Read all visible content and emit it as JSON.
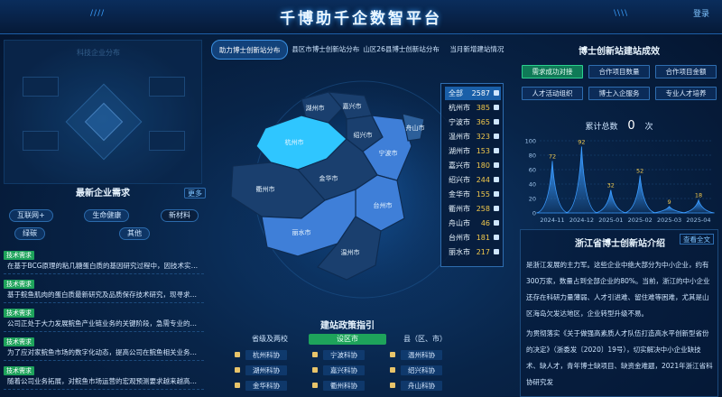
{
  "header": {
    "title": "千博助千企数智平台",
    "login_label": "登录",
    "deco_left": "////",
    "deco_right": "\\\\\\\\"
  },
  "left": {
    "faint_title": "科技企业分布",
    "demand_title": "最新企业需求",
    "demand_more": "更多",
    "tags_row1": [
      "互联网+",
      "生命健康",
      "新材料"
    ],
    "tags_row2": [
      "绿碳",
      "其他"
    ],
    "badge_label": "技术需求",
    "demands": [
      "在基于BCG原理的粘几糖蛋白质的基因研究过程中，因技术实现、数...",
      "基于鲩鱼肌肉的蛋白质最新研究及品质保存技术研究，现寻求专...",
      "公司正处于大力发展鲩鱼产业链业务的关键阶段，急需专业的鲩鱼...",
      "为了应对家鲩鱼市场的数字化动态，提高公司在鲩鱼相关业务的...",
      "随着公司业务拓展，对鲩鱼市场运营的宏观预测要求越来越高，现需..."
    ]
  },
  "center": {
    "tabs": [
      "助力博士创新站分布",
      "县区市博士创新站分布",
      "山区26县博士创新站分布",
      "当月新增建站情况"
    ],
    "map_labels": {
      "hz": "杭州市",
      "jx": "嘉兴市",
      "huz": "湖州市",
      "sx": "绍兴市",
      "nb": "宁波市",
      "zs": "舟山市",
      "jh": "金华市",
      "qz": "衢州市",
      "tz": "台州市",
      "ls": "丽水市",
      "wz": "温州市"
    },
    "city_list": [
      {
        "name": "全部",
        "value": "2587"
      },
      {
        "name": "杭州市",
        "value": "385"
      },
      {
        "name": "宁波市",
        "value": "365"
      },
      {
        "name": "温州市",
        "value": "323"
      },
      {
        "name": "湖州市",
        "value": "153"
      },
      {
        "name": "嘉兴市",
        "value": "180"
      },
      {
        "name": "绍兴市",
        "value": "244"
      },
      {
        "name": "金华市",
        "value": "155"
      },
      {
        "name": "衢州市",
        "value": "258"
      },
      {
        "name": "舟山市",
        "value": "46"
      },
      {
        "name": "台州市",
        "value": "181"
      },
      {
        "name": "丽水市",
        "value": "217"
      }
    ],
    "policy_title": "建站政策指引",
    "policy_tabs": [
      "省级及两校",
      "设区市",
      "县（区、市）"
    ],
    "policy_rows": [
      [
        "杭州科协",
        "宁波科协",
        "温州科协"
      ],
      [
        "湖州科协",
        "嘉兴科协",
        "绍兴科协"
      ],
      [
        "金华科协",
        "衢州科协",
        "舟山科协"
      ]
    ]
  },
  "right": {
    "results_title": "博士创新站建站成效",
    "btn_row1": [
      "需求成功对接",
      "合作项目数量",
      "合作项目金额"
    ],
    "btn_row2": [
      "人才活动组织",
      "博士入企服务",
      "专业人才培养"
    ],
    "total_label": "累计总数",
    "total_value": "0",
    "total_unit": "次",
    "intro_title": "浙江省博士创新站介绍",
    "intro_more": "查看全文",
    "intro_paragraphs": [
      "是浙江发展的主力军。这些企业中绝大部分为中小企业，约有300万家，数量占到全部企业的80%。当前，浙江的中小企业还存在科研力量薄弱、人才引进难、留住难等困难，尤其是山区海岛欠发达地区，企业转型升级不易。",
      "为贯彻落实《关于做强高素质人才队伍打造高水平创新型省份的决定》（浙委发〔2020〕19号），切实解决中小企业缺技术、缺人才，青年博士缺项目、缺资金难题，2021年浙江省科协研究发"
    ]
  },
  "chart_data": {
    "type": "area",
    "categories": [
      "2024-11",
      "2024-12",
      "2025-01",
      "2025-02",
      "2025-03",
      "2025-04"
    ],
    "values": [
      72,
      92,
      32,
      52,
      9,
      18
    ],
    "ylim": [
      0,
      100
    ],
    "yticks": [
      "0",
      "20",
      "40",
      "60",
      "80",
      "100"
    ],
    "title": "",
    "xlabel": "",
    "ylabel": "",
    "color": "#3a9bff"
  },
  "colors": {
    "accent": "#3a9bff",
    "highlight_city": "#2fc6ff",
    "badge_green": "#1ea35b",
    "value_gold": "#f2c94c"
  }
}
